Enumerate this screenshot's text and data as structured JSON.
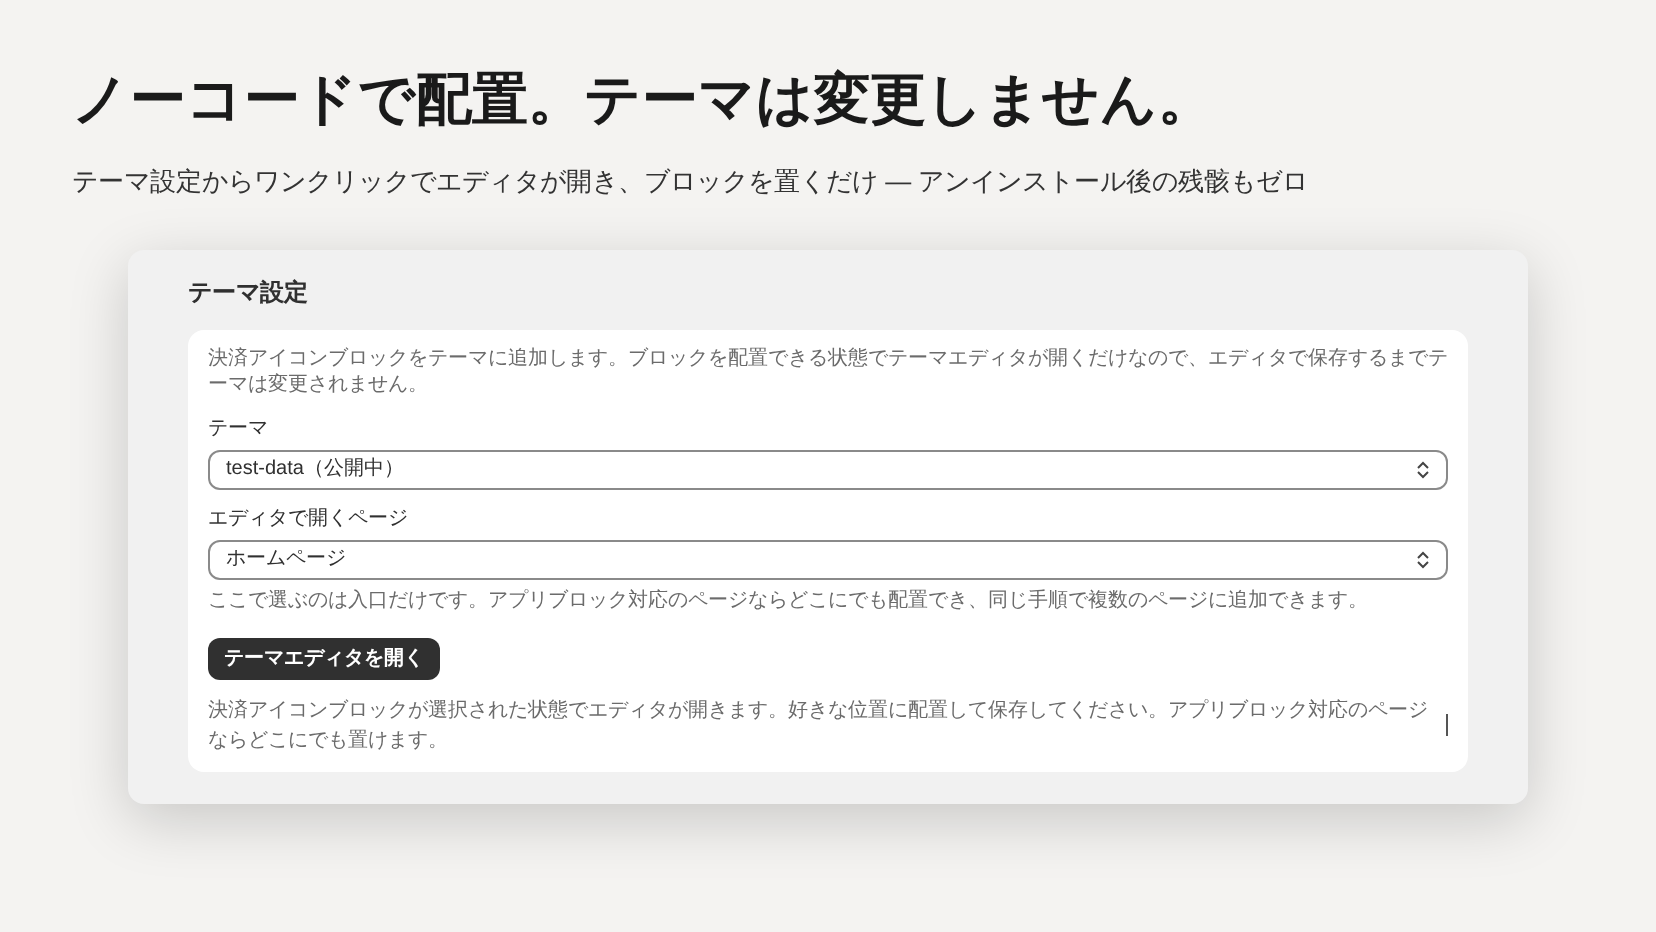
{
  "hero": {
    "title": "ノーコードで配置。テーマは変更しません。",
    "subtitle": "テーマ設定からワンクリックでエディタが開き、ブロックを置くだけ — アンインストール後の残骸もゼロ"
  },
  "panel": {
    "title": "テーマ設定",
    "description": "決済アイコンブロックをテーマに追加します。ブロックを配置できる状態でテーマエディタが開くだけなので、エディタで保存するまでテーマは変更されません。",
    "fields": [
      {
        "label": "テーマ",
        "value": "test-data（公開中）"
      },
      {
        "label": "エディタで開くページ",
        "value": "ホームページ",
        "help": "ここで選ぶのは入口だけです。アプリブロック対応のページならどこにでも配置でき、同じ手順で複数のページに追加できます。"
      }
    ],
    "button": "テーマエディタを開く",
    "note": "決済アイコンブロックが選択された状態でエディタが開きます。好きな位置に配置して保存してください。アプリブロック対応のページならどこにでも置けます。"
  }
}
